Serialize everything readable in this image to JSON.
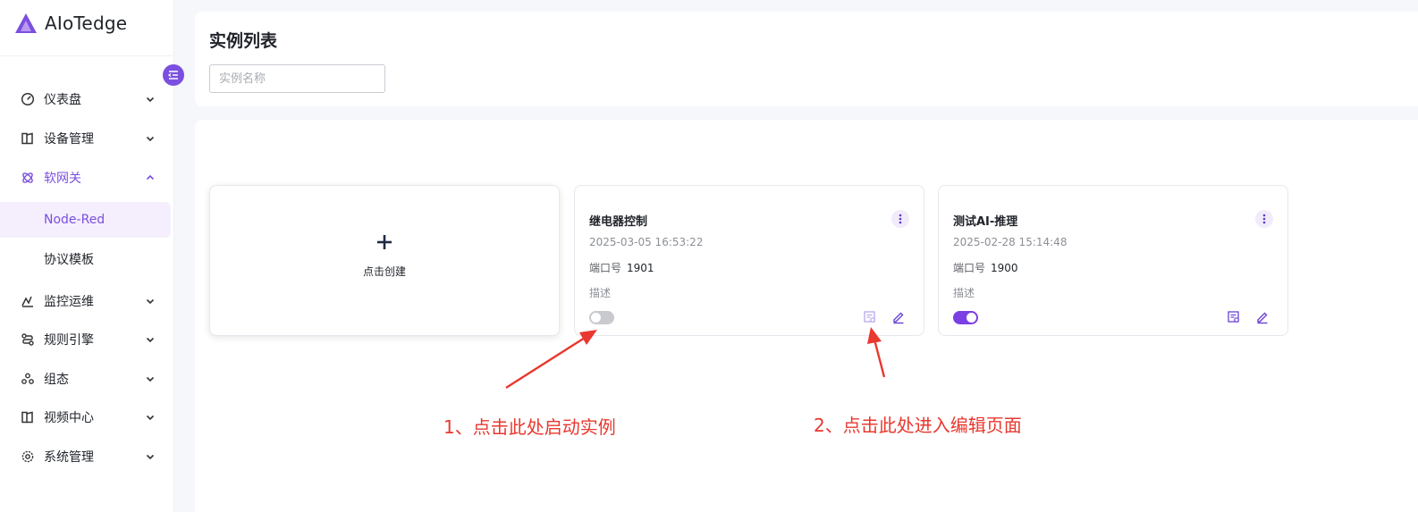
{
  "app": {
    "name": "AIoTedge",
    "accent": "#7b4fe0"
  },
  "sidebar": {
    "items": [
      {
        "label": "仪表盘",
        "icon": "gauge-icon"
      },
      {
        "label": "设备管理",
        "icon": "device-icon"
      },
      {
        "label": "软网关",
        "icon": "gateway-icon",
        "expanded": true
      },
      {
        "label": "监控运维",
        "icon": "monitor-icon"
      },
      {
        "label": "规则引擎",
        "icon": "rule-engine-icon"
      },
      {
        "label": "组态",
        "icon": "configuration-icon"
      },
      {
        "label": "视频中心",
        "icon": "video-icon"
      },
      {
        "label": "系统管理",
        "icon": "settings-icon"
      }
    ],
    "subitems": [
      {
        "label": "Node-Red",
        "selected": true
      },
      {
        "label": "协议模板",
        "selected": false
      }
    ]
  },
  "header": {
    "title": "实例列表",
    "search_placeholder": "实例名称"
  },
  "create_card": {
    "label": "点击创建"
  },
  "instances": [
    {
      "name": "继电器控制",
      "time": "2025-03-05 16:53:22",
      "port_label": "端口号",
      "port": "1901",
      "desc_label": "描述",
      "running": false
    },
    {
      "name": "测试AI-推理",
      "time": "2025-02-28 15:14:48",
      "port_label": "端口号",
      "port": "1900",
      "desc_label": "描述",
      "running": true
    }
  ],
  "annotations": {
    "start_hint": "1、点击此处启动实例",
    "edit_hint": "2、点击此处进入编辑页面",
    "color": "#e8382f"
  }
}
